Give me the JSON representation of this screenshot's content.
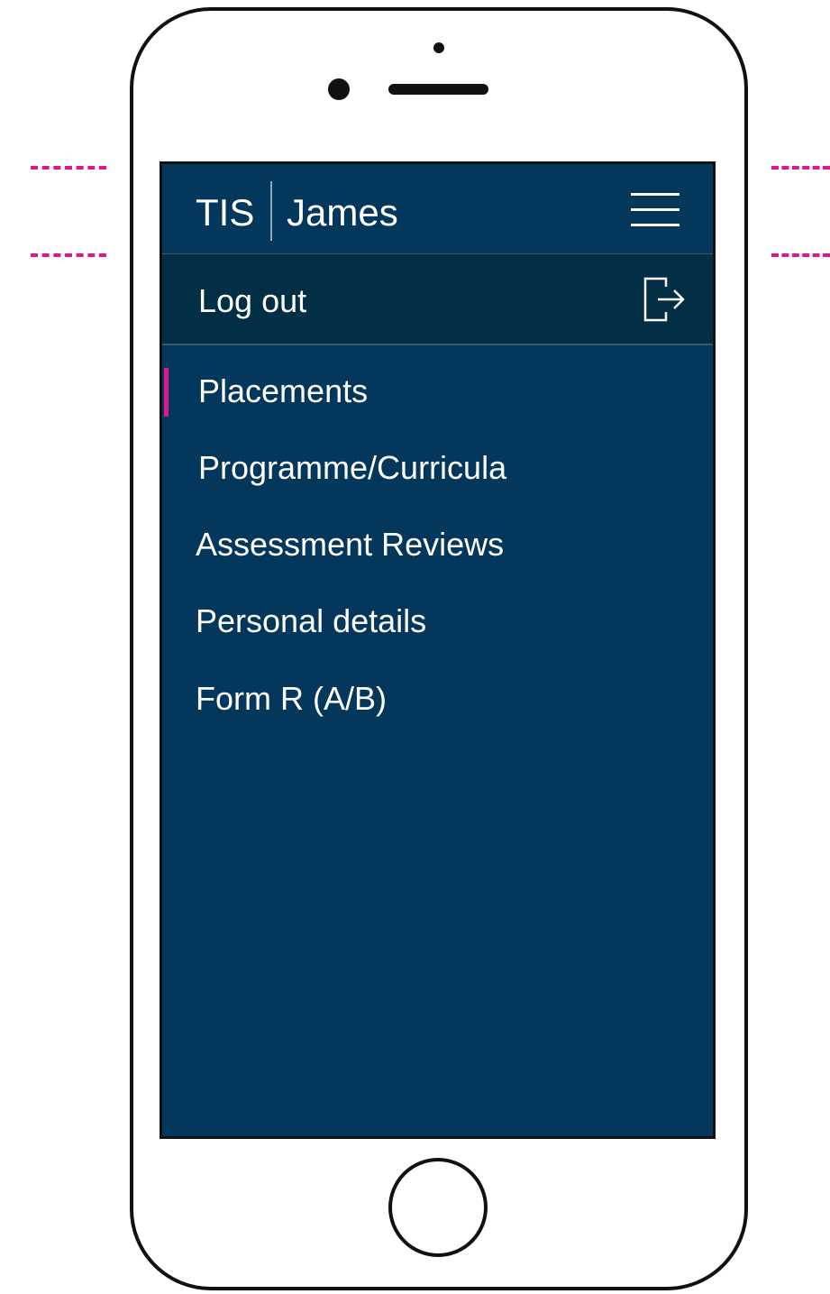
{
  "app": {
    "brand": "TIS",
    "user_name": "James"
  },
  "menu": {
    "icon": "hamburger-menu-icon",
    "logout_label": "Log out",
    "logout_icon": "logout-icon",
    "active_color": "#e0168c",
    "background_color": "#03375b",
    "items": [
      {
        "label": "Placements",
        "active": true
      },
      {
        "label": "Programme/Curricula",
        "active": false
      },
      {
        "label": "Assessment Reviews",
        "active": false
      },
      {
        "label": "Personal details",
        "active": false
      },
      {
        "label": "Form R (A/B)",
        "active": false
      }
    ]
  }
}
